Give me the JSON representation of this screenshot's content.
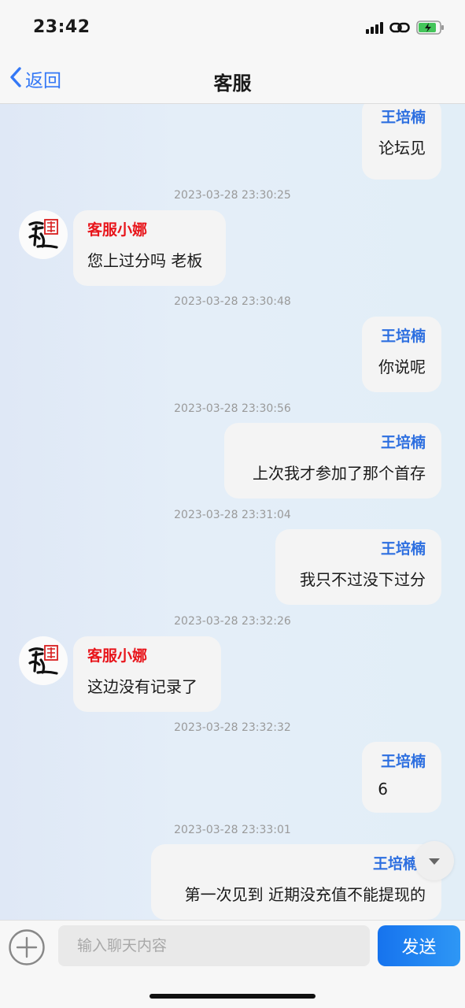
{
  "status_bar": {
    "time": "23:42"
  },
  "nav": {
    "back_label": "返回",
    "title": "客服"
  },
  "messages": [
    {
      "sender": "王培楠",
      "text": "论坛见"
    },
    {
      "timestamp": "2023-03-28 23:30:25",
      "sender": "客服小娜",
      "text": "您上过分吗 老板"
    },
    {
      "timestamp": "2023-03-28 23:30:48",
      "sender": "王培楠",
      "text": "你说呢"
    },
    {
      "timestamp": "2023-03-28 23:30:56",
      "sender": "王培楠",
      "text": "上次我才参加了那个首存"
    },
    {
      "timestamp": "2023-03-28 23:31:04",
      "sender": "王培楠",
      "text": "我只不过没下过分"
    },
    {
      "timestamp": "2023-03-28 23:32:26",
      "sender": "客服小娜",
      "text": "这边没有记录了"
    },
    {
      "timestamp": "2023-03-28 23:32:32",
      "sender": "王培楠",
      "text": "6"
    },
    {
      "timestamp": "2023-03-28 23:33:01",
      "sender": "王培楠",
      "text": "第一次见到 近期没充值不能提现的"
    }
  ],
  "input": {
    "placeholder": "输入聊天内容",
    "send_label": "发送"
  },
  "colors": {
    "accent": "#3478f6",
    "user_sender": "#2d6fe0",
    "agent_sender": "#e8151b",
    "send_button": "#1673ee"
  },
  "icons": {
    "back": "chevron-left-icon",
    "avatar": "agent-logo-icon",
    "scroll": "caret-down-icon",
    "plus": "plus-circle-icon"
  }
}
